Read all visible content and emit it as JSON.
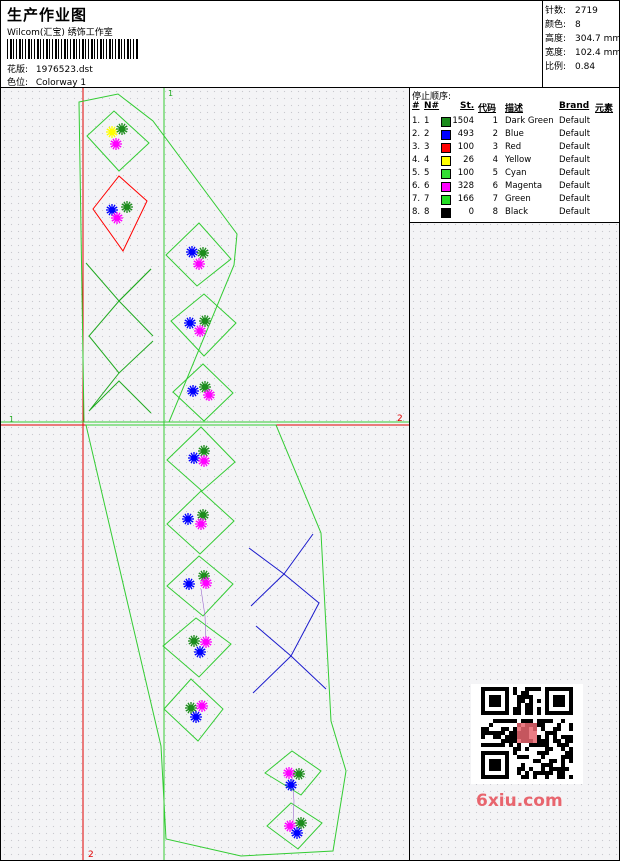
{
  "header": {
    "title": "生产作业图",
    "company": "Wilcom(汇宝) 绣饰工作室",
    "pattern_label": "花版:",
    "pattern_value": "1976523.dst",
    "color_label": "色位:",
    "color_value": "Colorway 1"
  },
  "stats": [
    {
      "label": "针数:",
      "value": "2719"
    },
    {
      "label": "颜色:",
      "value": "8"
    },
    {
      "label": "高度:",
      "value": "304.7 mm"
    },
    {
      "label": "宽度:",
      "value": "102.4 mm"
    },
    {
      "label": "比例:",
      "value": "0.84"
    }
  ],
  "stop_sequence": {
    "title": "停止顺序:",
    "headers": {
      "hash": "#",
      "no": "N#",
      "st": "St.",
      "code": "代码",
      "desc": "描述",
      "brand": "Brand",
      "elem": "元素"
    },
    "rows": [
      {
        "idx": "1.",
        "no": "1",
        "color": "#1c8c1c",
        "st": "1504",
        "code": "1",
        "desc": "Dark Green",
        "brand": "Default"
      },
      {
        "idx": "2.",
        "no": "2",
        "color": "#0000ff",
        "st": "493",
        "code": "2",
        "desc": "Blue",
        "brand": "Default"
      },
      {
        "idx": "3.",
        "no": "3",
        "color": "#ff0000",
        "st": "100",
        "code": "3",
        "desc": "Red",
        "brand": "Default"
      },
      {
        "idx": "4.",
        "no": "4",
        "color": "#ffff00",
        "st": "26",
        "code": "4",
        "desc": "Yellow",
        "brand": "Default"
      },
      {
        "idx": "5.",
        "no": "5",
        "color": "#33dd33",
        "st": "100",
        "code": "5",
        "desc": "Cyan",
        "brand": "Default"
      },
      {
        "idx": "6.",
        "no": "6",
        "color": "#ff00ff",
        "st": "328",
        "code": "6",
        "desc": "Magenta",
        "brand": "Default"
      },
      {
        "idx": "7.",
        "no": "7",
        "color": "#22dd22",
        "st": "166",
        "code": "7",
        "desc": "Green",
        "brand": "Default"
      },
      {
        "idx": "8.",
        "no": "8",
        "color": "#000000",
        "st": "0",
        "code": "8",
        "desc": "Black",
        "brand": "Default"
      }
    ]
  },
  "axes": {
    "marker1": "1",
    "marker2": "2"
  },
  "watermark": {
    "text": "6xiu.com",
    "color": "#e8656e"
  }
}
